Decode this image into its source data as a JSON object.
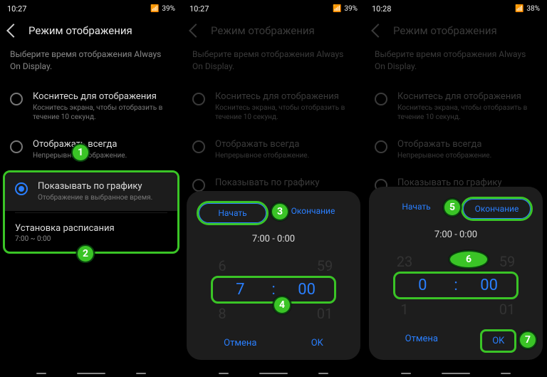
{
  "status": {
    "time1": "10:27",
    "time2": "10:27",
    "time3": "10:28",
    "battery1": "39%",
    "battery2": "39%",
    "battery3": "38%"
  },
  "header": {
    "title": "Режим отображения"
  },
  "subtitle": "Выберите время отображения Always On Display.",
  "options": {
    "tap": {
      "title": "Коснитесь для отображения",
      "sub": "Коснитесь экрана, чтобы отобразить в течение 10 секунд."
    },
    "always": {
      "title": "Отображать всегда",
      "sub": "Непрерывное отображение."
    },
    "sched": {
      "title": "Показывать по графику",
      "sub": "Отображение в выбранное время."
    }
  },
  "schedule": {
    "title": "Установка расписания",
    "value": "7:00 ~ 0:00"
  },
  "sheet": {
    "start": "Начать",
    "end": "Окончание",
    "range": "7:00   -   0:00",
    "cancel": "Отмена",
    "ok": "OK",
    "p1": {
      "topH": "6",
      "topM": "59",
      "h": "7",
      "m": "00",
      "botH": "8",
      "botM": "01"
    },
    "p2": {
      "topH": "23",
      "topM": "59",
      "h": "0",
      "m": "00",
      "botH": "1",
      "botM": "01"
    }
  },
  "badges": {
    "b1": "1",
    "b2": "2",
    "b3": "3",
    "b4": "4",
    "b5": "5",
    "b6": "6",
    "b7": "7"
  }
}
